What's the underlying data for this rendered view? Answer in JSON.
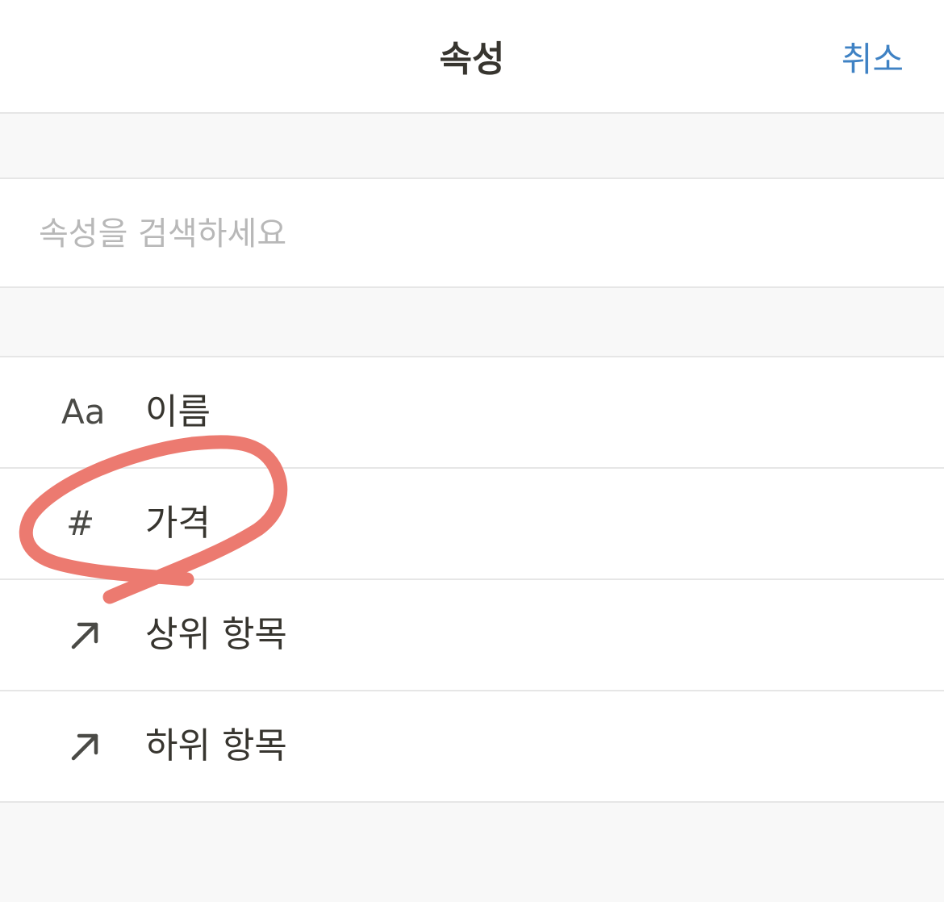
{
  "header": {
    "title": "속성",
    "cancel_label": "취소"
  },
  "search": {
    "value": "",
    "placeholder": "속성을 검색하세요"
  },
  "properties": [
    {
      "icon": "text-icon",
      "icon_text": "Aa",
      "label": "이름"
    },
    {
      "icon": "number-icon",
      "icon_text": "#",
      "label": "가격"
    },
    {
      "icon": "relation-arrow-icon",
      "icon_text": "",
      "label": "상위 항목"
    },
    {
      "icon": "relation-arrow-icon",
      "icon_text": "",
      "label": "하위 항목"
    }
  ],
  "colors": {
    "accent": "#3f82c4",
    "annotation": "#ec7a70",
    "text": "#37352f",
    "placeholder": "#b8b8b8",
    "divider": "#e6e6e6",
    "background": "#f8f8f8"
  }
}
